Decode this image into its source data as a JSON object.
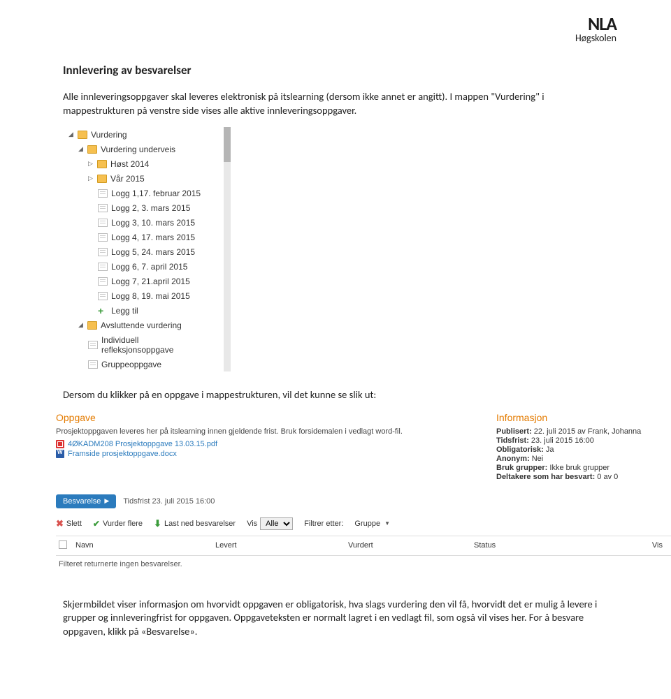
{
  "logo": {
    "line1": "NLA",
    "line2": "Høgskolen"
  },
  "title": "Innlevering av besvarelser",
  "para1": "Alle innleveringsoppgaver skal leveres elektronisk på itslearning (dersom ikke annet er angitt). I mappen \"Vurdering\" i mappestrukturen på venstre side vises alle aktive innleveringsoppgaver.",
  "para2": "Dersom du klikker på en oppgave i mappestrukturen, vil det kunne se slik ut:",
  "para3": "Skjermbildet viser informasjon om hvorvidt oppgaven er obligatorisk, hva slags vurdering den vil få, hvorvidt det er mulig å levere i grupper og innleveringfrist for oppgaven. Oppgaveteksten er normalt lagret i en vedlagt fil, som også vil vises her. For å besvare oppgaven, klikk på «Besvarelse».",
  "tree": {
    "root": "Vurdering",
    "sub1": "Vurdering underveis",
    "host": "Høst 2014",
    "var": "Vår 2015",
    "logs": [
      "Logg 1,17. februar 2015",
      "Logg 2, 3. mars 2015",
      "Logg 3, 10. mars 2015",
      "Logg 4, 17. mars 2015",
      "Logg 5, 24. mars 2015",
      "Logg 6, 7. april 2015",
      "Logg 7, 21.april 2015",
      "Logg 8, 19. mai 2015"
    ],
    "add": "Legg til",
    "sub2": "Avsluttende vurdering",
    "item_ind": "Individuell refleksjonsoppgave",
    "item_grp": "Gruppeoppgave"
  },
  "assign": {
    "left_heading": "Oppgave",
    "desc": "Prosjektoppgaven leveres her på itslearning innen gjeldende frist. Bruk forsidemalen i vedlagt word-fil.",
    "pdf": "4ØKADM208 Prosjektoppgave 13.03.15.pdf",
    "docx": "Framside prosjektoppgave.docx",
    "right_heading": "Informasjon",
    "info": {
      "pub_l": "Publisert:",
      "pub_v": "22. juli 2015 av Frank, Johanna",
      "dead_l": "Tidsfrist:",
      "dead_v": "23. juli 2015 16:00",
      "obl_l": "Obligatorisk:",
      "obl_v": "Ja",
      "anon_l": "Anonym:",
      "anon_v": "Nei",
      "grp_l": "Bruk grupper:",
      "grp_v": "Ikke bruk grupper",
      "part_l": "Deltakere som har besvart:",
      "part_v": "0 av 0"
    },
    "tab_label": "Besvarelse",
    "deadline_row": "Tidsfrist 23. juli 2015 16:00",
    "tools": {
      "slett": "Slett",
      "vurder": "Vurder flere",
      "lastned": "Last ned besvarelser",
      "vis_label": "Vis",
      "vis_value": "Alle",
      "filter_label": "Filtrer etter:",
      "filter_value": "Gruppe"
    },
    "cols": {
      "navn": "Navn",
      "levert": "Levert",
      "vurdert": "Vurdert",
      "status": "Status",
      "vis": "Vis"
    },
    "empty": "Filteret returnerte ingen besvarelser."
  }
}
